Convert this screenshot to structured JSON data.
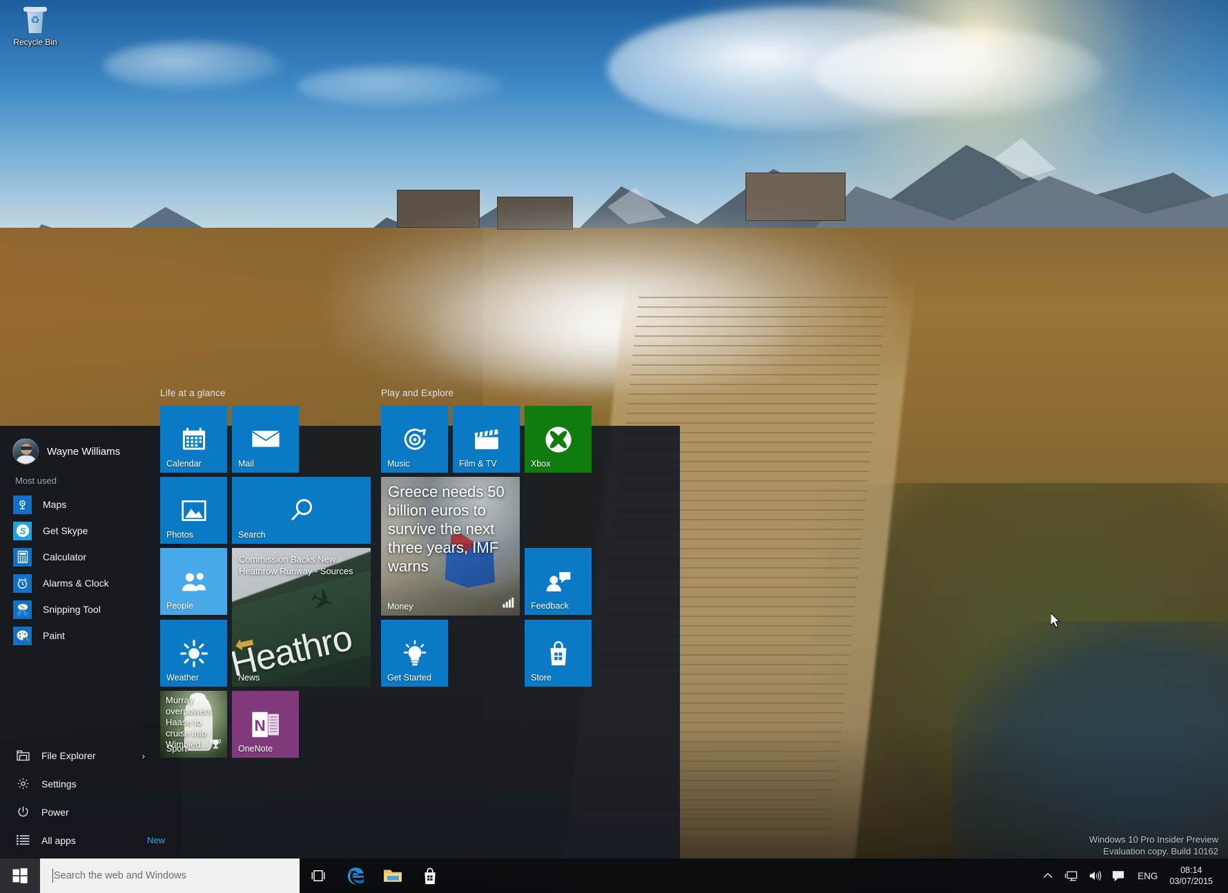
{
  "desktop": {
    "recycle_bin_label": "Recycle Bin",
    "watermark_line1": "Windows 10 Pro Insider Preview",
    "watermark_line2": "Evaluation copy. Build 10162"
  },
  "start_menu": {
    "user": {
      "name": "Wayne Williams",
      "avatar_icon": "user-avatar-photo"
    },
    "most_used_label": "Most used",
    "most_used": [
      {
        "label": "Maps",
        "icon": "maps-icon",
        "color": "#1072c6"
      },
      {
        "label": "Get Skype",
        "icon": "skype-icon",
        "color": "#18a5e0"
      },
      {
        "label": "Calculator",
        "icon": "calculator-icon",
        "color": "#1072c6"
      },
      {
        "label": "Alarms & Clock",
        "icon": "alarm-clock-icon",
        "color": "#1072c6"
      },
      {
        "label": "Snipping Tool",
        "icon": "snipping-tool-icon",
        "color": "#1072c6"
      },
      {
        "label": "Paint",
        "icon": "paint-icon",
        "color": "#1072c6"
      }
    ],
    "bottom_items": [
      {
        "label": "File Explorer",
        "icon": "folder-icon",
        "chevron": "›"
      },
      {
        "label": "Settings",
        "icon": "gear-icon",
        "chevron": ""
      },
      {
        "label": "Power",
        "icon": "power-icon",
        "chevron": ""
      },
      {
        "label": "All apps",
        "icon": "list-icon",
        "chevron": "",
        "badge": "New"
      }
    ],
    "groups": [
      {
        "title": "Life at a glance",
        "tiles": [
          {
            "name": "calendar",
            "label": "Calendar",
            "icon": "calendar-icon",
            "color": "#0a7ac6",
            "size": "medium"
          },
          {
            "name": "mail",
            "label": "Mail",
            "icon": "mail-envelope-icon",
            "color": "#0a7ac6",
            "size": "medium"
          },
          {
            "name": "photos",
            "label": "Photos",
            "icon": "photo-picture-icon",
            "color": "#0a7ac6",
            "size": "medium"
          },
          {
            "name": "search",
            "label": "Search",
            "icon": "magnifier-icon",
            "color": "#0a7ac6",
            "size": "wide"
          },
          {
            "name": "people",
            "label": "People",
            "icon": "people-icon",
            "color": "#49a8e8",
            "size": "medium"
          },
          {
            "name": "news",
            "label": "News",
            "icon": "news-photo",
            "headline": "Commission Backs New Heathrow Runway - Sources",
            "size": "large"
          },
          {
            "name": "weather",
            "label": "Weather",
            "icon": "sun-icon",
            "color": "#0a7ac6",
            "size": "medium"
          },
          {
            "name": "sport",
            "label": "Sport",
            "icon": "trophy-icon",
            "headline": "Murray overpowers Haase to cruise into Wimbled...",
            "size": "medium"
          },
          {
            "name": "onenote",
            "label": "OneNote",
            "icon": "onenote-n-icon",
            "color": "#80397b",
            "size": "medium"
          }
        ]
      },
      {
        "title": "Play and Explore",
        "tiles": [
          {
            "name": "music",
            "label": "Music",
            "icon": "music-disc-icon",
            "color": "#0a7ac6",
            "size": "medium"
          },
          {
            "name": "film-tv",
            "label": "Film & TV",
            "icon": "clapperboard-icon",
            "color": "#0a7ac6",
            "size": "medium"
          },
          {
            "name": "xbox",
            "label": "Xbox",
            "icon": "xbox-sphere-icon",
            "color": "#107c10",
            "size": "medium"
          },
          {
            "name": "money",
            "label": "Money",
            "icon": "chart-bars-icon",
            "headline": "Greece needs 50 billion euros to survive the next three years, IMF warns",
            "size": "large"
          },
          {
            "name": "feedback",
            "label": "Feedback",
            "icon": "feedback-person-speech-icon",
            "color": "#0a7ac6",
            "size": "medium"
          },
          {
            "name": "get-started",
            "label": "Get Started",
            "icon": "lightbulb-icon",
            "color": "#0a7ac6",
            "size": "medium"
          },
          {
            "name": "store",
            "label": "Store",
            "icon": "shopping-bag-icon",
            "color": "#0a7ac6",
            "size": "medium"
          }
        ]
      }
    ]
  },
  "taskbar": {
    "start_button_icon": "windows-logo-icon",
    "search_placeholder": "Search the web and Windows",
    "search_value": "",
    "pinned": [
      {
        "name": "task-view",
        "icon": "task-view-icon"
      },
      {
        "name": "microsoft-edge",
        "icon": "edge-e-icon"
      },
      {
        "name": "file-explorer",
        "icon": "folder-icon"
      },
      {
        "name": "store",
        "icon": "shopping-bag-icon"
      }
    ],
    "tray": [
      {
        "name": "show-hidden-icons",
        "icon": "chevron-up-icon"
      },
      {
        "name": "network",
        "icon": "network-monitor-icon"
      },
      {
        "name": "volume",
        "icon": "speaker-icon"
      },
      {
        "name": "action-center",
        "icon": "action-center-icon"
      }
    ],
    "language": "ENG",
    "time": "08:14",
    "date": "03/07/2015"
  }
}
